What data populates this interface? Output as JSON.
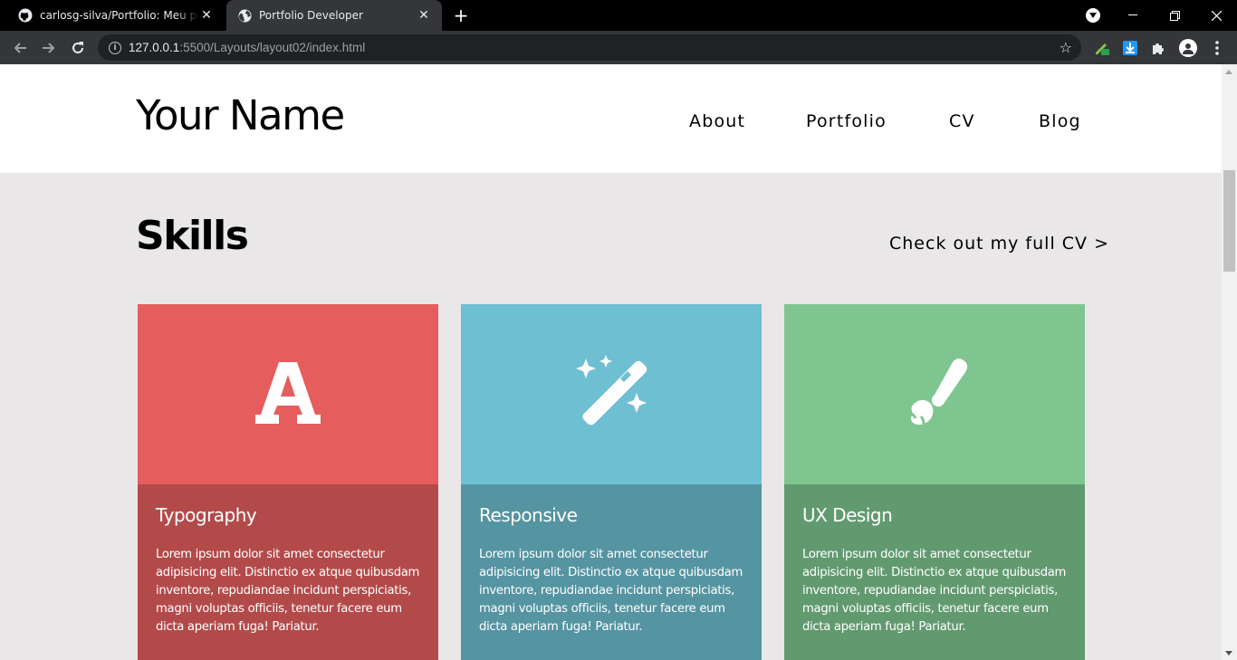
{
  "browser": {
    "tabs": [
      {
        "title": "carlosg-silva/Portfolio: Meu portfolio",
        "icon": "github-icon",
        "active": false
      },
      {
        "title": "Portfolio Developer",
        "icon": "globe-icon",
        "active": true
      }
    ],
    "new_tab_label": "+",
    "url": {
      "host": "127.0.0.1",
      "path": ":5500/Layouts/layout02/index.html"
    }
  },
  "site": {
    "logo": "Your Name",
    "menu": [
      "About",
      "Portfolio",
      "CV",
      "Blog"
    ],
    "skills_title": "Skills",
    "cv_link": "Check out my full CV >",
    "cards": [
      {
        "title": "Typography",
        "icon": "typography-a-icon",
        "top_color": "#e55d5d",
        "bottom_color": "#b34a4a",
        "text": "Lorem ipsum dolor sit amet consectetur adipisicing elit. Distinctio ex atque quibusdam inventore, repudiandae incidunt perspiciatis, magni voluptas officiis, tenetur facere eum dicta aperiam fuga! Pariatur."
      },
      {
        "title": "Responsive",
        "icon": "magic-wand-icon",
        "top_color": "#6fbfd2",
        "bottom_color": "#5594a1",
        "text": "Lorem ipsum dolor sit amet consectetur adipisicing elit. Distinctio ex atque quibusdam inventore, repudiandae incidunt perspiciatis, magni voluptas officiis, tenetur facere eum dicta aperiam fuga! Pariatur."
      },
      {
        "title": "UX Design",
        "icon": "paint-brush-icon",
        "top_color": "#7fc590",
        "bottom_color": "#629a70",
        "text": "Lorem ipsum dolor sit amet consectetur adipisicing elit. Distinctio ex atque quibusdam inventore, repudiandae incidunt perspiciatis, magni voluptas officiis, tenetur facere eum dicta aperiam fuga! Pariatur."
      }
    ]
  }
}
